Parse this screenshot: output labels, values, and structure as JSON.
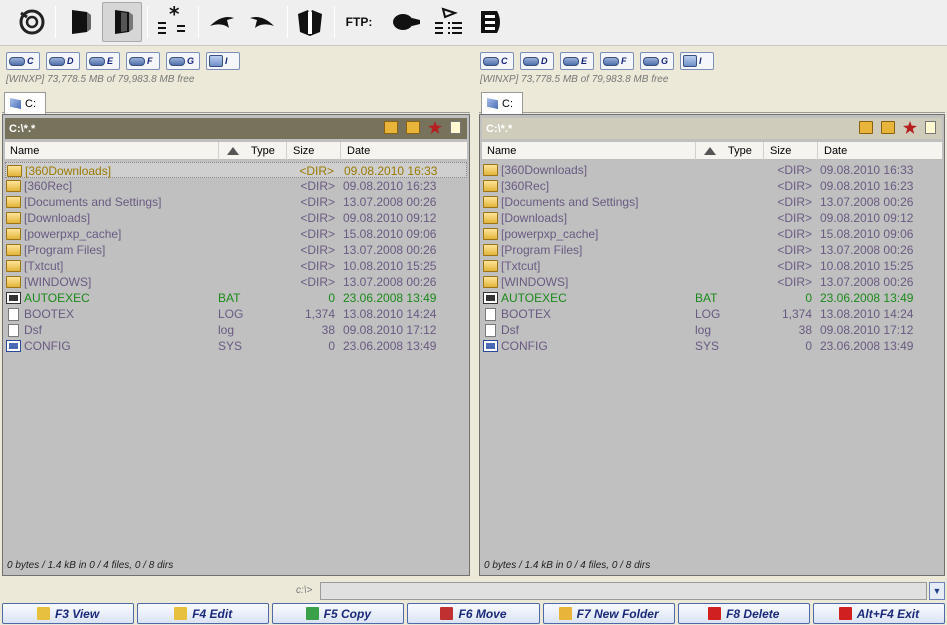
{
  "toolbar": {
    "ftp_label": "FTP:"
  },
  "drives": [
    {
      "letter": "C",
      "icon": "drive-icon"
    },
    {
      "letter": "D",
      "icon": "drive-icon"
    },
    {
      "letter": "E",
      "icon": "drive-icon"
    },
    {
      "letter": "F",
      "icon": "drive-icon"
    },
    {
      "letter": "G",
      "icon": "drive-icon"
    },
    {
      "letter": "I",
      "icon": "network-drive-icon"
    }
  ],
  "left": {
    "free_info": "[WINXP]  73,778.5 MB of  79,983.8 MB free",
    "tab_label": "C:",
    "path": "C:\\*.*",
    "status": "0 bytes / 1.4 kB in 0 / 4 files, 0 / 8 dirs"
  },
  "right": {
    "free_info": "[WINXP]  73,778.5 MB of  79,983.8 MB free",
    "tab_label": "C:",
    "path": "C:\\*.*",
    "status": "0 bytes / 1.4 kB in 0 / 4 files, 0 / 8 dirs"
  },
  "columns": {
    "name": "Name",
    "type": "Type",
    "size": "Size",
    "date": "Date"
  },
  "files": [
    {
      "name": "[360Downloads]",
      "type": "",
      "size": "<DIR>",
      "date": "09.08.2010 16:33",
      "kind": "dir"
    },
    {
      "name": "[360Rec]",
      "type": "",
      "size": "<DIR>",
      "date": "09.08.2010 16:23",
      "kind": "dir"
    },
    {
      "name": "[Documents and Settings]",
      "type": "",
      "size": "<DIR>",
      "date": "13.07.2008 00:26",
      "kind": "dir"
    },
    {
      "name": "[Downloads]",
      "type": "",
      "size": "<DIR>",
      "date": "09.08.2010 09:12",
      "kind": "dir"
    },
    {
      "name": "[powerpxp_cache]",
      "type": "",
      "size": "<DIR>",
      "date": "15.08.2010 09:06",
      "kind": "dir"
    },
    {
      "name": "[Program Files]",
      "type": "",
      "size": "<DIR>",
      "date": "13.07.2008 00:26",
      "kind": "dir"
    },
    {
      "name": "[Txtcut]",
      "type": "",
      "size": "<DIR>",
      "date": "10.08.2010 15:25",
      "kind": "dir"
    },
    {
      "name": "[WINDOWS]",
      "type": "",
      "size": "<DIR>",
      "date": "13.07.2008 00:26",
      "kind": "dir"
    },
    {
      "name": "AUTOEXEC",
      "type": "BAT",
      "size": "0",
      "date": "23.06.2008 13:49",
      "kind": "bat"
    },
    {
      "name": "BOOTEX",
      "type": "LOG",
      "size": "1,374",
      "date": "13.08.2010 14:24",
      "kind": "log"
    },
    {
      "name": "Dsf",
      "type": "log",
      "size": "38",
      "date": "09.08.2010 17:12",
      "kind": "log"
    },
    {
      "name": "CONFIG",
      "type": "SYS",
      "size": "0",
      "date": "23.06.2008 13:49",
      "kind": "sys"
    }
  ],
  "cmdline": {
    "label": "c:\\>",
    "value": ""
  },
  "fkeys": [
    {
      "label": "F3 View",
      "color": "#e8c040"
    },
    {
      "label": "F4 Edit",
      "color": "#e8c040"
    },
    {
      "label": "F5 Copy",
      "color": "#3aa04a"
    },
    {
      "label": "F6 Move",
      "color": "#c03030"
    },
    {
      "label": "F7 New Folder",
      "color": "#e8b43a"
    },
    {
      "label": "F8 Delete",
      "color": "#d02020"
    },
    {
      "label": "Alt+F4 Exit",
      "color": "#d02020"
    }
  ]
}
